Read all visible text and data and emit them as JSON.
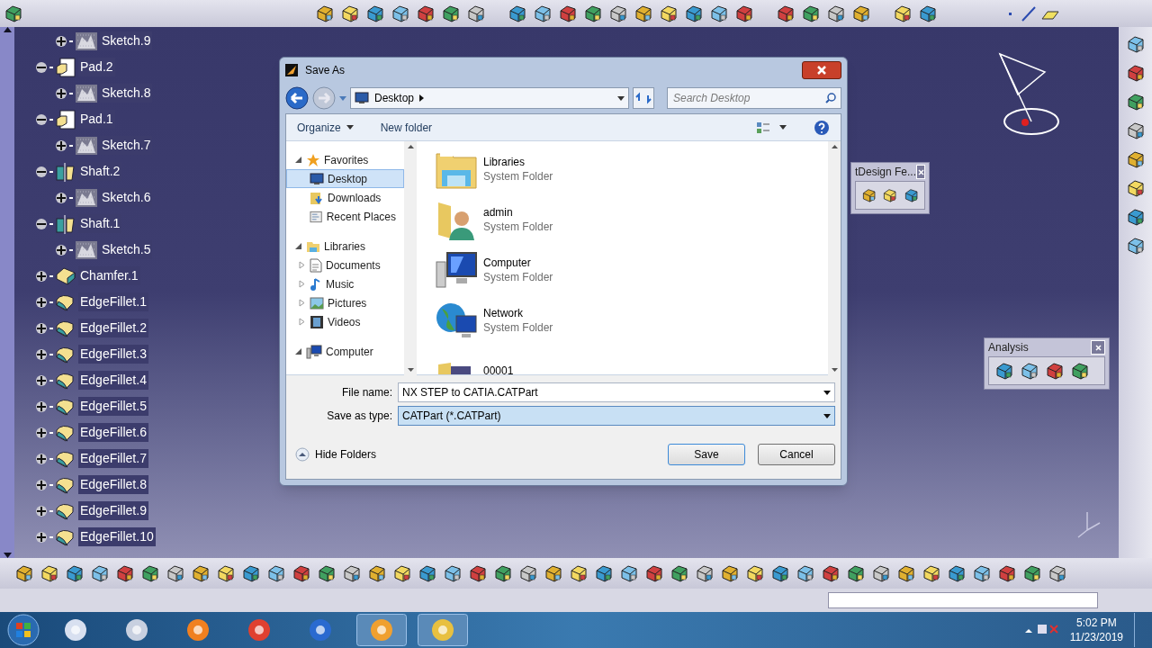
{
  "tree": {
    "items": [
      {
        "children": [
          {
            "label": "Sketch.9",
            "kind": "sketch",
            "expanded": false
          }
        ]
      },
      {
        "label": "Pad.2",
        "kind": "pad",
        "expanded": true,
        "children": [
          {
            "label": "Sketch.8",
            "kind": "sketch",
            "expanded": false
          }
        ]
      },
      {
        "label": "Pad.1",
        "kind": "pad",
        "expanded": true,
        "children": [
          {
            "label": "Sketch.7",
            "kind": "sketch",
            "expanded": false
          }
        ]
      },
      {
        "label": "Shaft.2",
        "kind": "shaft",
        "expanded": true,
        "children": [
          {
            "label": "Sketch.6",
            "kind": "sketch",
            "expanded": false
          }
        ]
      },
      {
        "label": "Shaft.1",
        "kind": "shaft",
        "expanded": true,
        "children": [
          {
            "label": "Sketch.5",
            "kind": "sketch",
            "expanded": false
          }
        ]
      },
      {
        "label": "Chamfer.1",
        "kind": "chamfer",
        "expanded": false
      },
      {
        "label": "EdgeFillet.1",
        "kind": "fillet",
        "expanded": false
      },
      {
        "label": "EdgeFillet.2",
        "kind": "fillet",
        "expanded": false
      },
      {
        "label": "EdgeFillet.3",
        "kind": "fillet",
        "expanded": false
      },
      {
        "label": "EdgeFillet.4",
        "kind": "fillet",
        "expanded": false
      },
      {
        "label": "EdgeFillet.5",
        "kind": "fillet",
        "expanded": false
      },
      {
        "label": "EdgeFillet.6",
        "kind": "fillet",
        "expanded": false
      },
      {
        "label": "EdgeFillet.7",
        "kind": "fillet",
        "expanded": false
      },
      {
        "label": "EdgeFillet.8",
        "kind": "fillet",
        "expanded": false
      },
      {
        "label": "EdgeFillet.9",
        "kind": "fillet",
        "expanded": false
      },
      {
        "label": "EdgeFillet.10",
        "kind": "fillet",
        "expanded": false
      }
    ]
  },
  "floating_toolbars": [
    {
      "title": "tDesign Fe..."
    },
    {
      "title": "Analysis"
    }
  ],
  "dialog": {
    "title": "Save As",
    "address": "Desktop",
    "search": {
      "placeholder": "Search Desktop"
    },
    "toolbar": [
      "Organize",
      "New folder"
    ],
    "nav": [
      {
        "label": "Favorites",
        "kind": "favorites",
        "expanded": true,
        "selected": false,
        "children": [
          {
            "label": "Desktop",
            "kind": "desktop",
            "selected": true
          },
          {
            "label": "Downloads",
            "kind": "downloads",
            "selected": false
          },
          {
            "label": "Recent Places",
            "kind": "recent",
            "selected": false
          }
        ]
      },
      {
        "label": "Libraries",
        "kind": "libraries",
        "expanded": true,
        "selected": false,
        "children": [
          {
            "label": "Documents",
            "kind": "documents",
            "expanded": false,
            "selected": false
          },
          {
            "label": "Music",
            "kind": "music",
            "expanded": false,
            "selected": false
          },
          {
            "label": "Pictures",
            "kind": "pictures",
            "expanded": false,
            "selected": false
          },
          {
            "label": "Videos",
            "kind": "videos",
            "expanded": false,
            "selected": false
          }
        ]
      },
      {
        "label": "Computer",
        "kind": "computer",
        "expanded": true,
        "selected": false
      }
    ],
    "files": [
      {
        "name": "Libraries",
        "type": "System Folder",
        "kind": "libraries"
      },
      {
        "name": "admin",
        "type": "System Folder",
        "kind": "user"
      },
      {
        "name": "Computer",
        "type": "System Folder",
        "kind": "computer"
      },
      {
        "name": "Network",
        "type": "System Folder",
        "kind": "network"
      },
      {
        "name": "00001",
        "kind": "folder"
      }
    ],
    "file_name": {
      "label": "File name:",
      "value": "NX STEP to CATIA.CATPart"
    },
    "save_type": {
      "label": "Save as type:",
      "value": "CATPart (*.CATPart)"
    },
    "hide_folders": "Hide Folders",
    "buttons": [
      "Save",
      "Cancel"
    ]
  },
  "taskbar": {
    "time": "5:02 PM",
    "date": "11/23/2019"
  }
}
